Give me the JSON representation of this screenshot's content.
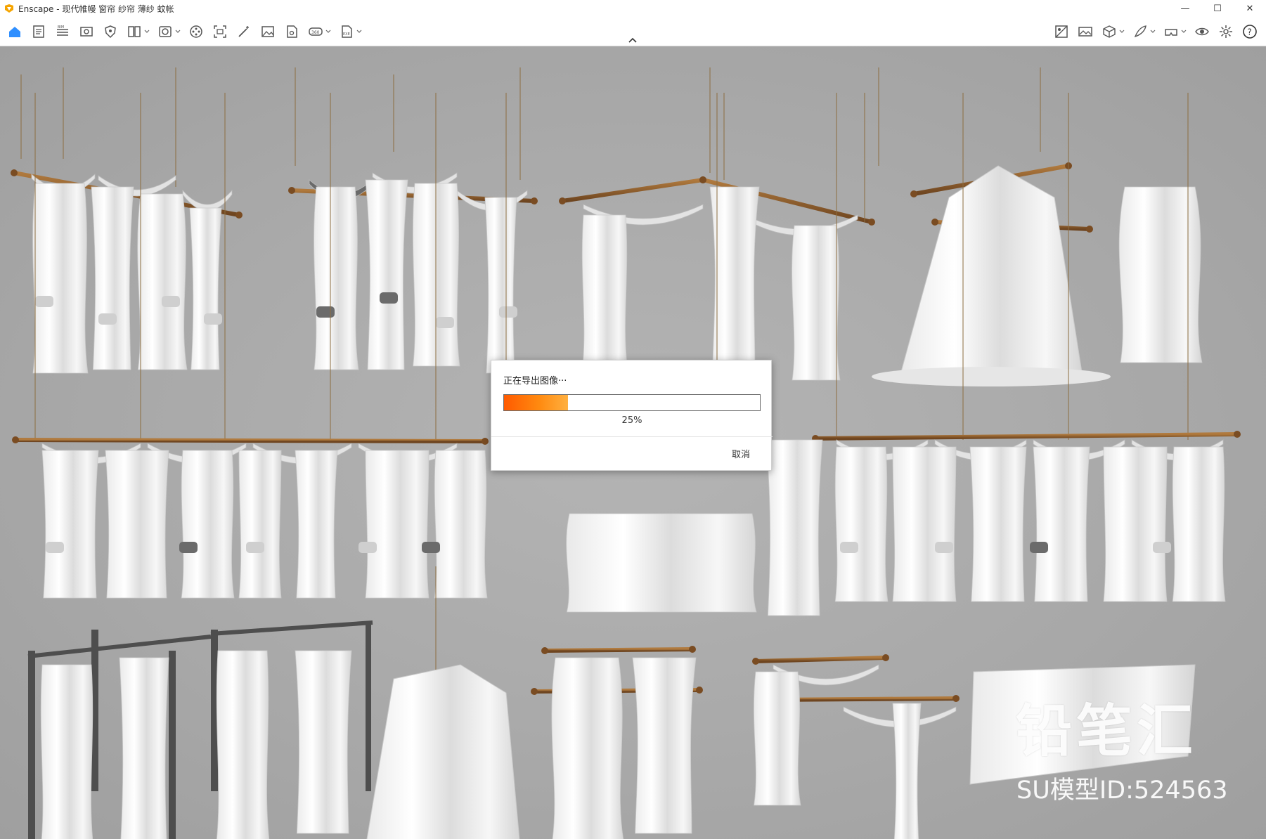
{
  "window": {
    "title": "Enscape - 现代帷幔 窗帘 纱帘 薄纱 蚊帐",
    "controls": {
      "minimize": "—",
      "maximize": "☐",
      "close": "✕"
    }
  },
  "toolbar": {
    "left_tools": [
      {
        "name": "home-icon",
        "kind": "home"
      },
      {
        "name": "document-icon",
        "kind": "doc"
      },
      {
        "name": "bim-icon",
        "kind": "bim"
      },
      {
        "name": "view-icon",
        "kind": "view"
      },
      {
        "name": "shield-icon",
        "kind": "shield"
      },
      {
        "name": "layout-icon",
        "kind": "layout"
      },
      {
        "name": "asset-icon",
        "kind": "asset"
      },
      {
        "name": "film-icon",
        "kind": "film"
      },
      {
        "name": "screenshot-icon",
        "kind": "capture"
      },
      {
        "name": "magic-icon",
        "kind": "magic"
      },
      {
        "name": "image-icon",
        "kind": "image"
      },
      {
        "name": "pdf-export-icon",
        "kind": "pdf"
      },
      {
        "name": "panorama-icon",
        "kind": "pano"
      },
      {
        "name": "exe-export-icon",
        "kind": "exe"
      }
    ],
    "right_tools": [
      {
        "name": "material-icon",
        "kind": "material"
      },
      {
        "name": "gallery-icon",
        "kind": "gallery"
      },
      {
        "name": "cube-icon",
        "kind": "cube"
      },
      {
        "name": "feather-icon",
        "kind": "feather"
      },
      {
        "name": "vr-icon",
        "kind": "vr"
      },
      {
        "name": "eye-icon",
        "kind": "eye"
      },
      {
        "name": "settings-icon",
        "kind": "gear"
      },
      {
        "name": "help-icon",
        "kind": "help"
      }
    ],
    "accent_color": "#2f8fff"
  },
  "dialog": {
    "title": "正在导出图像···",
    "progress_fraction": 0.25,
    "progress_label": "25%",
    "cancel_label": "取消",
    "fill_color": "#ff6a00"
  },
  "watermark": {
    "brand": "铅笔汇",
    "model_id": "SU模型ID:524563"
  }
}
